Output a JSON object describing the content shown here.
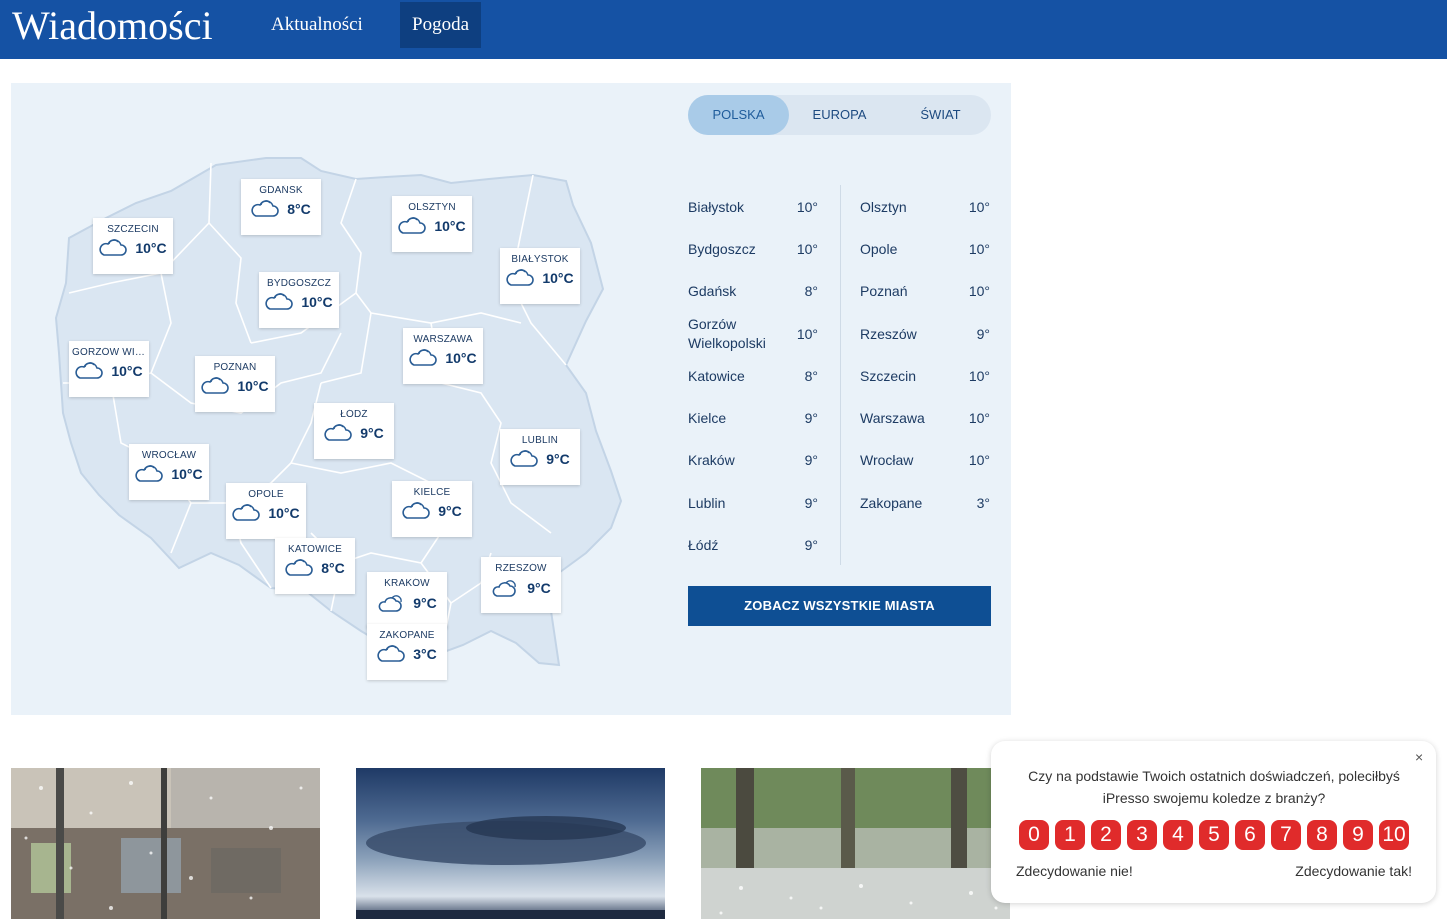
{
  "header": {
    "brand": "Wiadomości",
    "nav": [
      {
        "label": "Aktualności",
        "active": false
      },
      {
        "label": "Pogoda",
        "active": true
      }
    ]
  },
  "weather": {
    "tabs": [
      {
        "label": "POLSKA",
        "active": true
      },
      {
        "label": "EUROPA",
        "active": false
      },
      {
        "label": "ŚWIAT",
        "active": false
      }
    ],
    "map_cards": [
      {
        "name": "GDAŃSK",
        "temp": "8°C",
        "icon": "cloud-icon"
      },
      {
        "name": "OLSZTYN",
        "temp": "10°C",
        "icon": "cloud-icon"
      },
      {
        "name": "SZCZECIN",
        "temp": "10°C",
        "icon": "cloud-icon"
      },
      {
        "name": "BIAŁYSTOK",
        "temp": "10°C",
        "icon": "cloud-icon"
      },
      {
        "name": "BYDGOSZCZ",
        "temp": "10°C",
        "icon": "cloud-icon"
      },
      {
        "name": "WARSZAWA",
        "temp": "10°C",
        "icon": "cloud-icon"
      },
      {
        "name": "GORZÓW WIELK...",
        "temp": "10°C",
        "icon": "cloud-icon"
      },
      {
        "name": "POZNAŃ",
        "temp": "10°C",
        "icon": "cloud-icon"
      },
      {
        "name": "ŁÓDŹ",
        "temp": "9°C",
        "icon": "cloud-icon"
      },
      {
        "name": "LUBLIN",
        "temp": "9°C",
        "icon": "cloud-icon"
      },
      {
        "name": "WROCŁAW",
        "temp": "10°C",
        "icon": "cloud-icon"
      },
      {
        "name": "OPOLE",
        "temp": "10°C",
        "icon": "cloud-icon"
      },
      {
        "name": "KIELCE",
        "temp": "9°C",
        "icon": "cloud-icon"
      },
      {
        "name": "KATOWICE",
        "temp": "8°C",
        "icon": "cloud-icon"
      },
      {
        "name": "RZESZÓW",
        "temp": "9°C",
        "icon": "partly-cloudy-icon"
      },
      {
        "name": "KRAKÓW",
        "temp": "9°C",
        "icon": "partly-cloudy-icon"
      },
      {
        "name": "ZAKOPANE",
        "temp": "3°C",
        "icon": "cloud-icon"
      }
    ],
    "list_left": [
      {
        "name": "Białystok",
        "value": "10°"
      },
      {
        "name": "Bydgoszcz",
        "value": "10°"
      },
      {
        "name": "Gdańsk",
        "value": "8°"
      },
      {
        "name": "Gorzów Wielkopolski",
        "value": "10°"
      },
      {
        "name": "Katowice",
        "value": "8°"
      },
      {
        "name": "Kielce",
        "value": "9°"
      },
      {
        "name": "Kraków",
        "value": "9°"
      },
      {
        "name": "Lublin",
        "value": "9°"
      },
      {
        "name": "Łódź",
        "value": "9°"
      }
    ],
    "list_right": [
      {
        "name": "Olsztyn",
        "value": "10°"
      },
      {
        "name": "Opole",
        "value": "10°"
      },
      {
        "name": "Poznań",
        "value": "10°"
      },
      {
        "name": "Rzeszów",
        "value": "9°"
      },
      {
        "name": "Szczecin",
        "value": "10°"
      },
      {
        "name": "Warszawa",
        "value": "10°"
      },
      {
        "name": "Wrocław",
        "value": "10°"
      },
      {
        "name": "Zakopane",
        "value": "3°"
      }
    ],
    "cta_label": "ZOBACZ WSZYSTKIE MIASTA"
  },
  "survey": {
    "close": "×",
    "question": "Czy na podstawie Twoich ostatnich doświadczeń, poleciłbyś iPresso swojemu koledze z branży?",
    "scores": [
      "0",
      "1",
      "2",
      "3",
      "4",
      "5",
      "6",
      "7",
      "8",
      "9",
      "10"
    ],
    "label_low": "Zdecydowanie nie!",
    "label_high": "Zdecydowanie tak!"
  },
  "colors": {
    "header_bg": "#1552a4",
    "nav_active_bg": "#0e3f80",
    "panel_bg": "#eaf2f9",
    "cta_bg": "#0e4f94",
    "score_bg": "#e02b2b"
  }
}
